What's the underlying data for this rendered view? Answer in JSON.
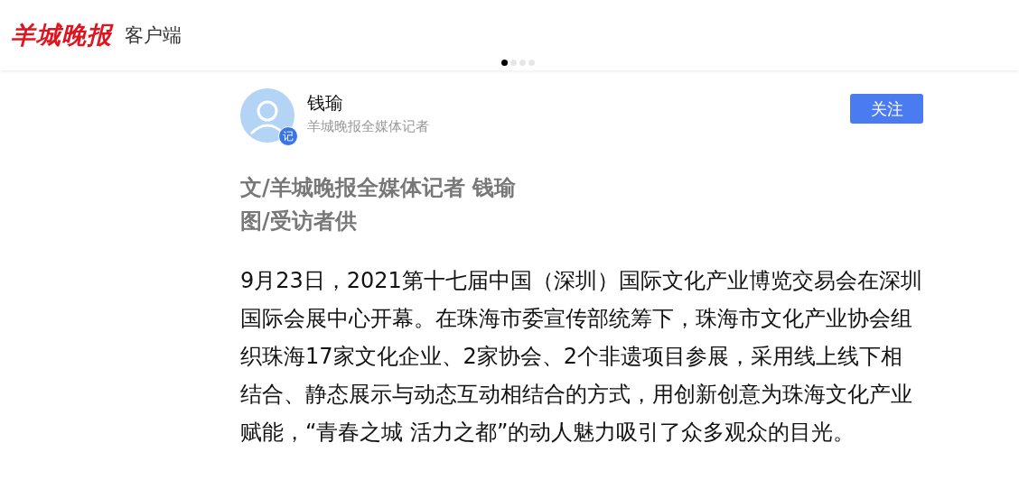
{
  "header": {
    "logo": "羊城晚报",
    "subtitle": "客户端"
  },
  "pager": [
    {
      "selected": true
    },
    {
      "selected": false
    },
    {
      "selected": false
    },
    {
      "selected": false
    }
  ],
  "author": {
    "badge": "记",
    "name": "钱瑜",
    "title": "羊城晚报全媒体记者",
    "follow_button": "关注"
  },
  "byline": [
    "文/羊城晚报全媒体记者 钱瑜",
    "图/受访者供"
  ],
  "body": "9月23日，2021第十七届中国（深圳）国际文化产业博览交易会在深圳国际会展中心开幕。在珠海市委宣传部统筹下，珠海市文化产业协会组织珠海17家文化企业、2家协会、2个非遗项目参展，采用线上线下相结合、静态展示与动态互动相结合的方式，用创新创意为珠海文化产业赋能，“青春之城 活力之都”的动人魅力吸引了众多观众的目光。"
}
